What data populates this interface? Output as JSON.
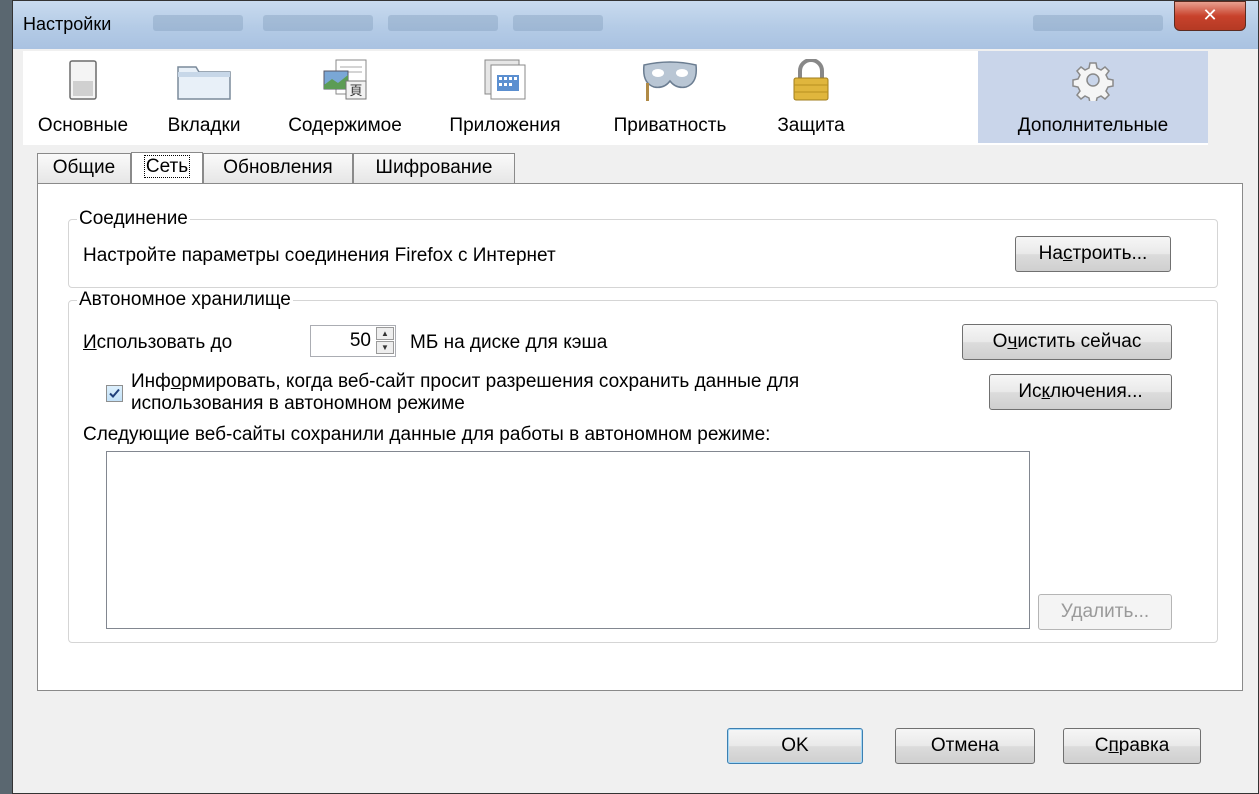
{
  "window": {
    "title": "Настройки",
    "close_glyph": "✕"
  },
  "toolbar": {
    "items": [
      {
        "label": "Основные",
        "icon": "switch-icon"
      },
      {
        "label": "Вкладки",
        "icon": "tabs-icon"
      },
      {
        "label": "Содержимое",
        "icon": "content-icon"
      },
      {
        "label": "Приложения",
        "icon": "applications-icon"
      },
      {
        "label": "Приватность",
        "icon": "mask-icon"
      },
      {
        "label": "Защита",
        "icon": "lock-icon"
      },
      {
        "label": "Дополнительные",
        "icon": "gear-icon"
      }
    ],
    "active": "Дополнительные"
  },
  "tabs": [
    {
      "label": "Общие"
    },
    {
      "label": "Сеть"
    },
    {
      "label": "Обновления"
    },
    {
      "label": "Шифрование"
    }
  ],
  "active_tab": "Сеть",
  "connection": {
    "legend": "Соединение",
    "description": "Настройте параметры соединения Firefox с Интернет",
    "configure_button": {
      "pre": "На",
      "accel": "с",
      "post": "троить..."
    }
  },
  "offline": {
    "legend": "Автономное хранилище",
    "use_label": {
      "accel": "И",
      "post": "спользовать до"
    },
    "cache_size": "50",
    "cache_unit_label": "МБ на диске для кэша",
    "clear_button": {
      "pre": "О",
      "accel": "ч",
      "post": "истить сейчас"
    },
    "notify_checked": true,
    "notify_label": {
      "pre": "Инф",
      "accel": "о",
      "post": "рмировать, когда веб-сайт просит разрешения сохранить данные для"
    },
    "notify_label_line2": "использования в автономном режиме",
    "exceptions_button": {
      "pre": "Ис",
      "accel": "к",
      "post": "лючения..."
    },
    "sites_label": "Следующие веб-сайты сохранили данные для работы в автономном режиме:",
    "sites": [],
    "remove_button": "Удалить..."
  },
  "footer": {
    "ok": "OK",
    "cancel": "Отмена",
    "help": {
      "pre": "С",
      "accel": "п",
      "post": "равка"
    }
  }
}
